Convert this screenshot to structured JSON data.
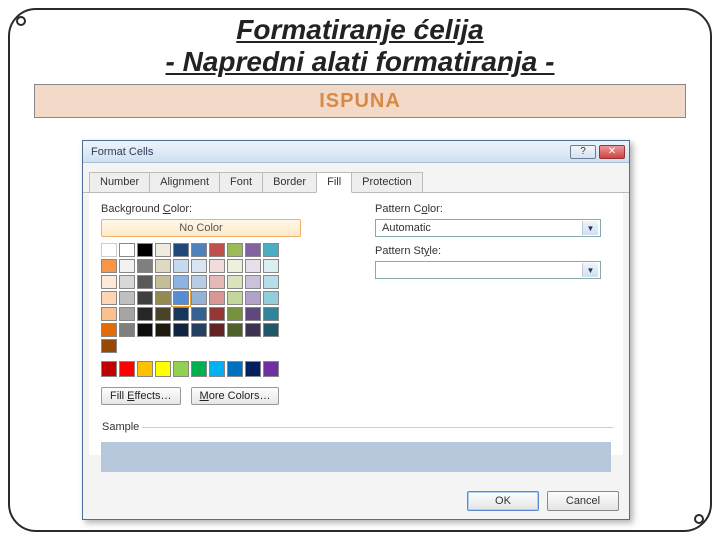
{
  "slide": {
    "title1": "Formatiranje ćelija",
    "title2": "- Napredni alati formatiranja -",
    "banner": "ISPUNA"
  },
  "dialog": {
    "title": "Format Cells",
    "helpGlyph": "?",
    "closeGlyph": "✕",
    "tabs": [
      "Number",
      "Alignment",
      "Font",
      "Border",
      "Fill",
      "Protection"
    ],
    "activeTab": 4,
    "bg": {
      "label_pre": "Background ",
      "label_u": "C",
      "label_post": "olor:",
      "noColor": "No Color",
      "themeColors": [
        "#ffffff",
        "#000000",
        "#eeece1",
        "#1f497d",
        "#4f81bd",
        "#c0504d",
        "#9bbb59",
        "#8064a2",
        "#4bacc6",
        "#f79646",
        "#f2f2f2",
        "#7f7f7f",
        "#ddd9c3",
        "#c6d9f0",
        "#dbe5f1",
        "#f2dcdb",
        "#ebf1dd",
        "#e5e0ec",
        "#dbeef3",
        "#fdeada",
        "#d8d8d8",
        "#595959",
        "#c4bd97",
        "#8db3e2",
        "#b8cce4",
        "#e5b9b7",
        "#d7e3bc",
        "#ccc1d9",
        "#b7dde8",
        "#fbd5b5",
        "#bfbfbf",
        "#3f3f3f",
        "#938953",
        "#548dd4",
        "#95b3d7",
        "#d99694",
        "#c3d69b",
        "#b2a2c7",
        "#92cddc",
        "#fac08f",
        "#a5a5a5",
        "#262626",
        "#494429",
        "#17365d",
        "#366092",
        "#953734",
        "#76923c",
        "#5f497a",
        "#31859b",
        "#e36c09",
        "#7f7f7f",
        "#0c0c0c",
        "#1d1b10",
        "#0f243e",
        "#244061",
        "#632423",
        "#4f6128",
        "#3f3151",
        "#205867",
        "#974806"
      ],
      "standardColors": [
        "#c00000",
        "#ff0000",
        "#ffc000",
        "#ffff00",
        "#92d050",
        "#00b050",
        "#00b0f0",
        "#0070c0",
        "#002060",
        "#7030a0"
      ],
      "fillEffects_pre": "Fill ",
      "fillEffects_u": "E",
      "fillEffects_post": "ffects…",
      "moreColors_u": "M",
      "moreColors_post": "ore Colors…"
    },
    "pattern": {
      "colorLabel_pre": "Pattern C",
      "colorLabel_u": "o",
      "colorLabel_post": "lor:",
      "colorValue": "Automatic",
      "styleLabel_pre": "Pattern St",
      "styleLabel_u": "y",
      "styleLabel_post": "le:",
      "styleValue": ""
    },
    "sampleLabel": "Sample",
    "sampleColor": "#b7c7dc",
    "ok": "OK",
    "cancel": "Cancel"
  }
}
